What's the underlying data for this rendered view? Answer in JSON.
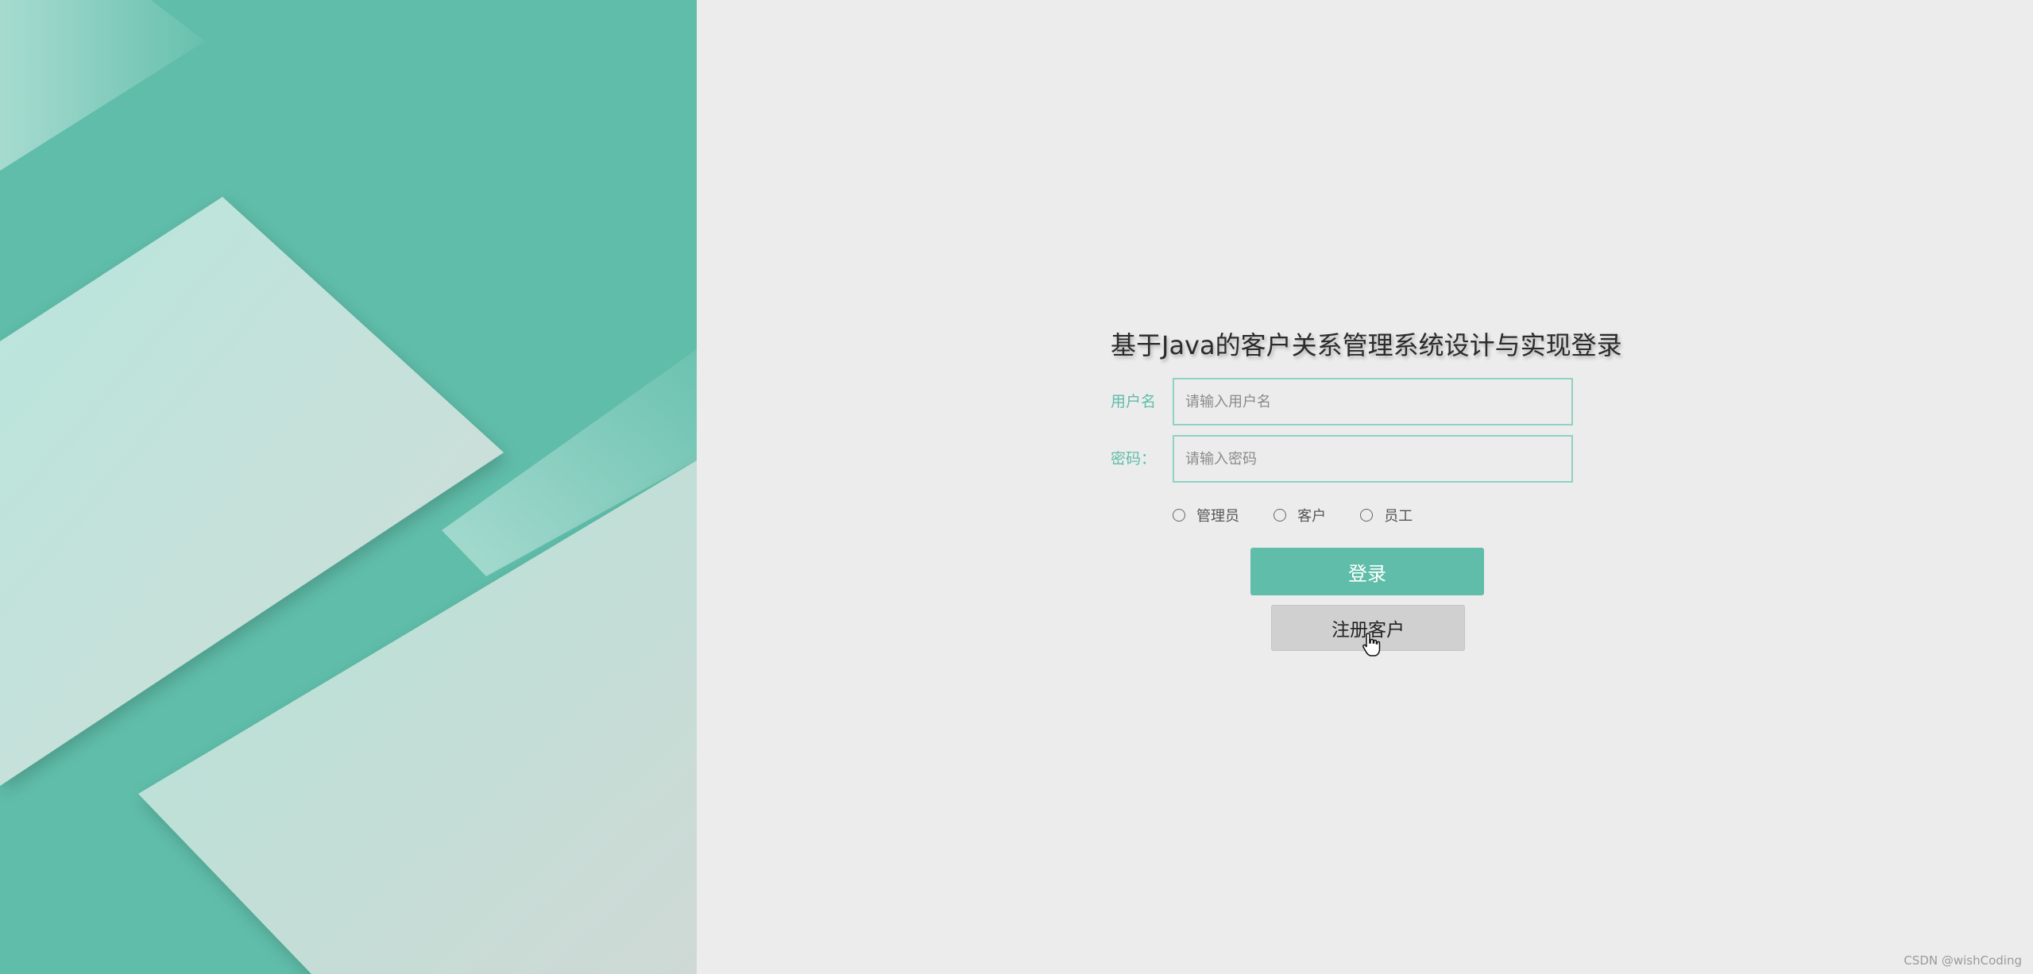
{
  "login": {
    "title": "基于Java的客户关系管理系统设计与实现登录",
    "username_label": "用户名",
    "username_placeholder": "请输入用户名",
    "password_label": "密码：",
    "password_placeholder": "请输入密码",
    "roles": [
      {
        "label": "管理员"
      },
      {
        "label": "客户"
      },
      {
        "label": "员工"
      }
    ],
    "login_button": "登录",
    "register_button": "注册客户"
  },
  "footer": {
    "watermark": "CSDN @wishCoding"
  },
  "colors": {
    "accent": "#5fbda9",
    "background": "#ececec",
    "register_button_bg": "#d0d0d0"
  },
  "icons": {
    "cursor": "hand-pointer-icon"
  }
}
